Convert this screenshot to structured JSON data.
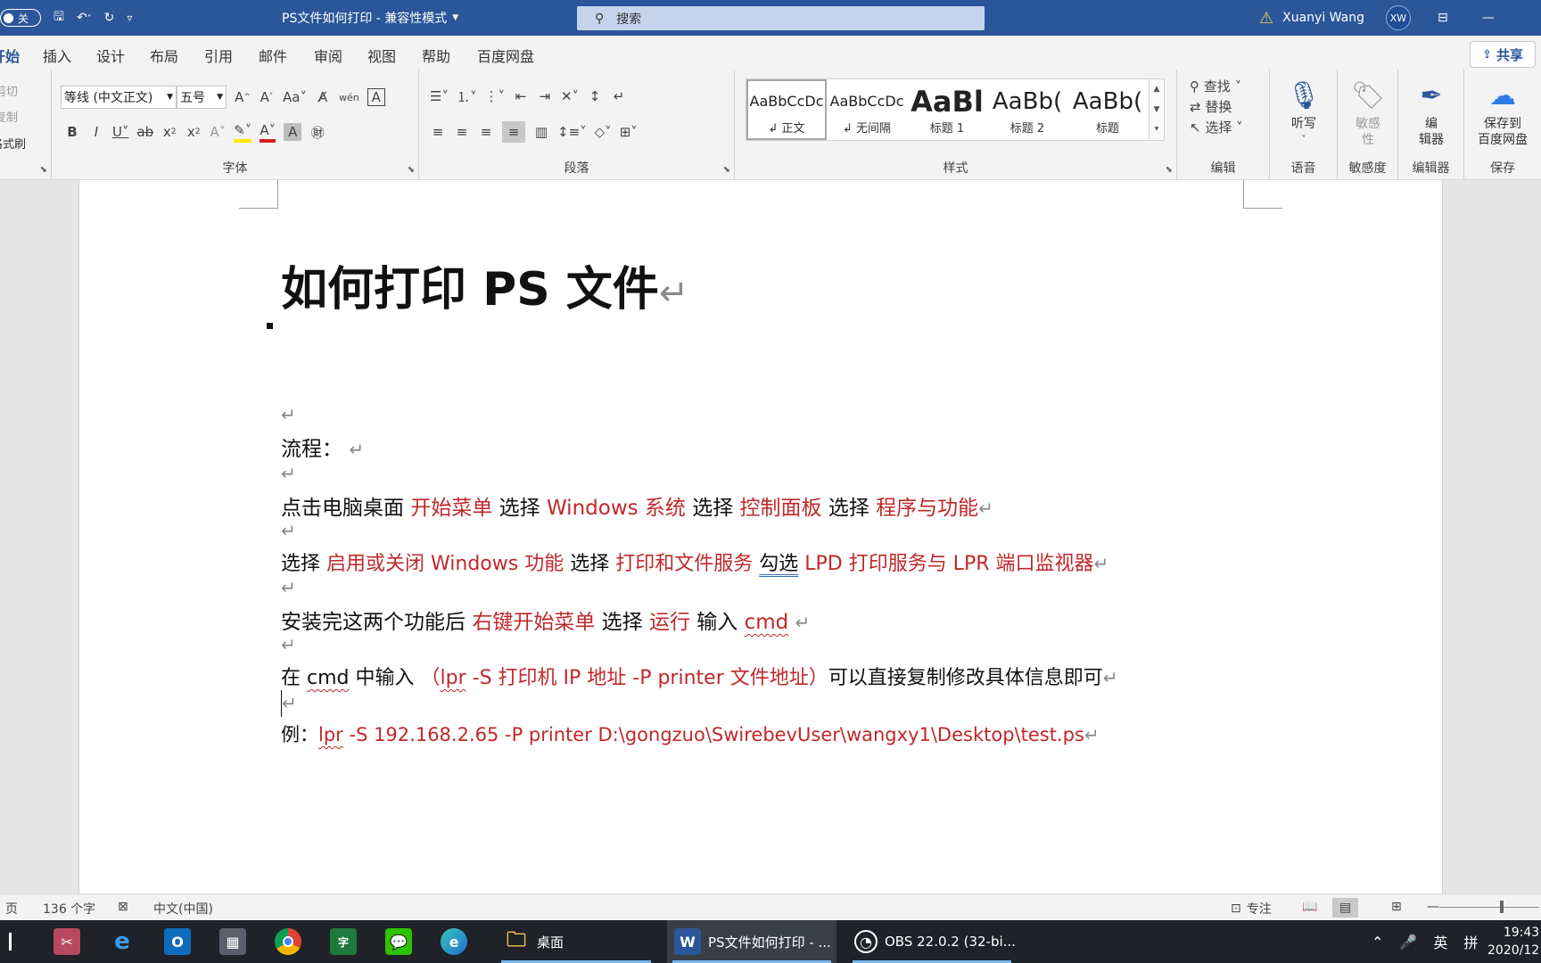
{
  "titlebar": {
    "autosave_state": "关",
    "doc_title": "PS文件如何打印  -  兼容性模式",
    "search_placeholder": "搜索",
    "user_name": "Xuanyi Wang",
    "user_initials": "XW"
  },
  "tabs": [
    "开始",
    "插入",
    "设计",
    "布局",
    "引用",
    "邮件",
    "审阅",
    "视图",
    "帮助",
    "百度网盘"
  ],
  "share_label": "共享",
  "ribbon": {
    "clipboard": [
      "剪切",
      "复制",
      "格式刷"
    ],
    "font": {
      "font_name": "等线 (中文正文)",
      "font_size": "五号",
      "group_label": "字体"
    },
    "paragraph": {
      "group_label": "段落"
    },
    "styles": {
      "group_label": "样式",
      "items": [
        {
          "preview": "AaBbCcDc",
          "name": "↲ 正文"
        },
        {
          "preview": "AaBbCcDc",
          "name": "↲ 无间隔"
        },
        {
          "preview": "AaBl",
          "name": "标题 1"
        },
        {
          "preview": "AaBb(",
          "name": "标题 2"
        },
        {
          "preview": "AaBb(",
          "name": "标题"
        }
      ]
    },
    "editing": {
      "group_label": "编辑",
      "find": "查找",
      "replace": "替换",
      "select": "选择"
    },
    "voice": {
      "button": "听写",
      "group_label": "语音"
    },
    "sensitivity": {
      "button_line1": "敏感",
      "button_line2": "性",
      "group_label": "敏感度"
    },
    "editor": {
      "button_line1": "编",
      "button_line2": "辑器",
      "group_label": "编辑器"
    },
    "save": {
      "button_line1": "保存到",
      "button_line2": "百度网盘",
      "group_label": "保存"
    }
  },
  "document": {
    "title": "如何打印 PS 文件",
    "lines": {
      "l_flow": "流程：",
      "l1": [
        "点击电脑桌面 ",
        "开始菜单",
        " 选择 ",
        "Windows 系统",
        " 选择 ",
        "控制面板",
        " 选择 ",
        "程序与功能"
      ],
      "l2": [
        "选择 ",
        "启用或关闭 Windows 功能",
        " 选择 ",
        "打印和文件服务",
        " ",
        "勾选",
        " ",
        "LPD 打印服务与 LPR 端口监视器"
      ],
      "l3": [
        "安装完这两个功能后 ",
        "右键开始菜单",
        " 选择 ",
        "运行",
        " 输入 ",
        "cmd"
      ],
      "l4": [
        "在 ",
        "cmd",
        " 中输入 ",
        "（",
        "lpr",
        " -S 打印机 IP 地址 -P printer 文件地址）",
        "可以直接复制修改具体信息即可"
      ],
      "l5": [
        "例：",
        "lpr",
        " -S 192.168.2.65 -P printer D:\\gongzuo\\SwirebevUser\\wangxy1\\Desktop\\test.ps"
      ]
    }
  },
  "statusbar": {
    "page": "页",
    "word_count": "136 个字",
    "language": "中文(中国)",
    "focus": "专注"
  },
  "taskbar": {
    "desktop_label": "桌面",
    "word_window": "PS文件如何打印 - ...",
    "obs_window": "OBS 22.0.2 (32-bi...",
    "ime": "英",
    "time": "19:43",
    "date": "2020/12"
  },
  "colors": {
    "titlebar": "#2b579a",
    "red_text": "#c0282b",
    "taskbar": "#1f2228"
  }
}
